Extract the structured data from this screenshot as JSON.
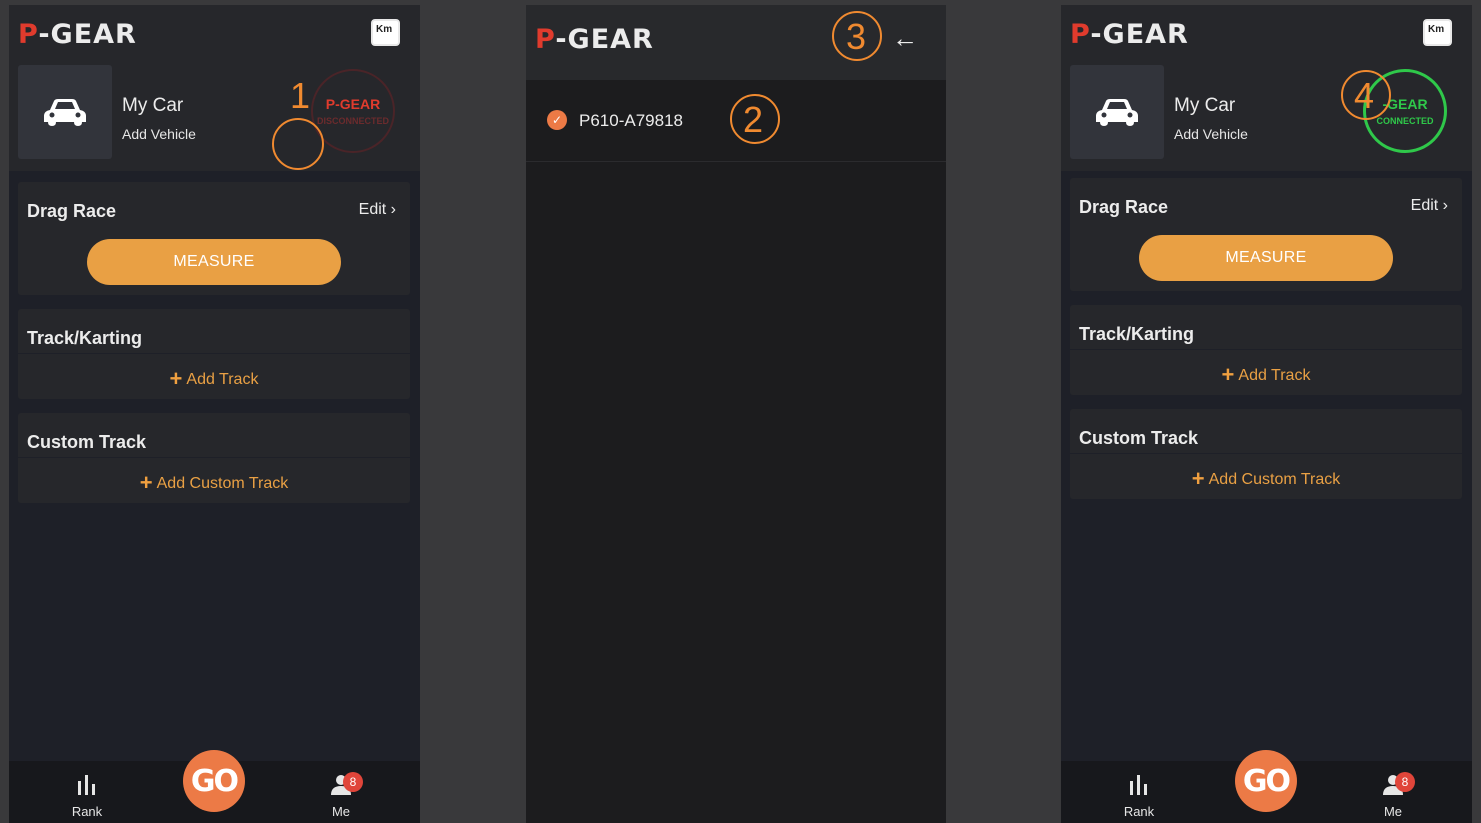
{
  "app": {
    "logo_prefix": "P",
    "logo_rest": "-GEAR",
    "unit_button": "Km"
  },
  "garage": {
    "title": "My Car",
    "subtitle": "Add Vehicle"
  },
  "device_status": {
    "name": "P-GEAR",
    "name_connected": "-GEAR",
    "disconnected": "DISCONNECTED",
    "connected": "CONNECTED",
    "color_disconnected": "#e03b2d",
    "color_connected": "#2fc84a"
  },
  "drag_race": {
    "title": "Drag Race",
    "edit": "Edit",
    "measure": "MEASURE"
  },
  "track": {
    "title": "Track/Karting",
    "add": "Add Track"
  },
  "custom_track": {
    "title": "Custom Track",
    "add": "Add Custom Track"
  },
  "nav": {
    "rank": "Rank",
    "go": "GO",
    "me": "Me",
    "me_badge": "8"
  },
  "device_list": {
    "items": [
      "P610-A79818"
    ]
  },
  "annotations": {
    "n1": "1",
    "n2": "2",
    "n3": "3",
    "n4": "4"
  },
  "colors": {
    "accent": "#e9a044",
    "go": "#ec7a46",
    "background": "#1e2028",
    "annotation": "#f08a30"
  }
}
